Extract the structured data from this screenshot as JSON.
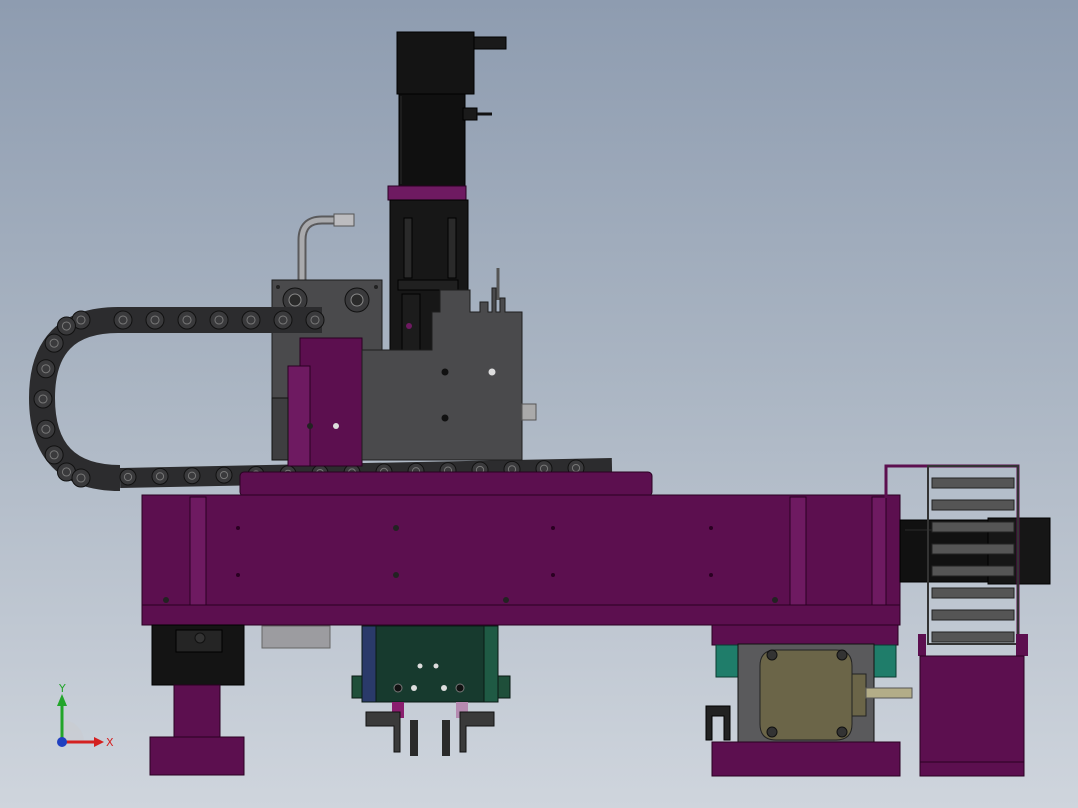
{
  "triad": {
    "x_label": "X",
    "y_label": "Y",
    "x_color": "#d42020",
    "y_color": "#22a52a",
    "origin_color": "#2040c0"
  },
  "colors": {
    "background_top": "#8e9cb0",
    "background_bottom": "#cfd5dd",
    "frame_purple": "#5c0f4f",
    "frame_purple_light": "#6e1a61",
    "plate_gray": "#4a4a4c",
    "motor_black": "#131313",
    "chain_dark": "#2c2c2e",
    "gripper_green": "#173a2e",
    "stepper_khaki": "#6b6548"
  }
}
